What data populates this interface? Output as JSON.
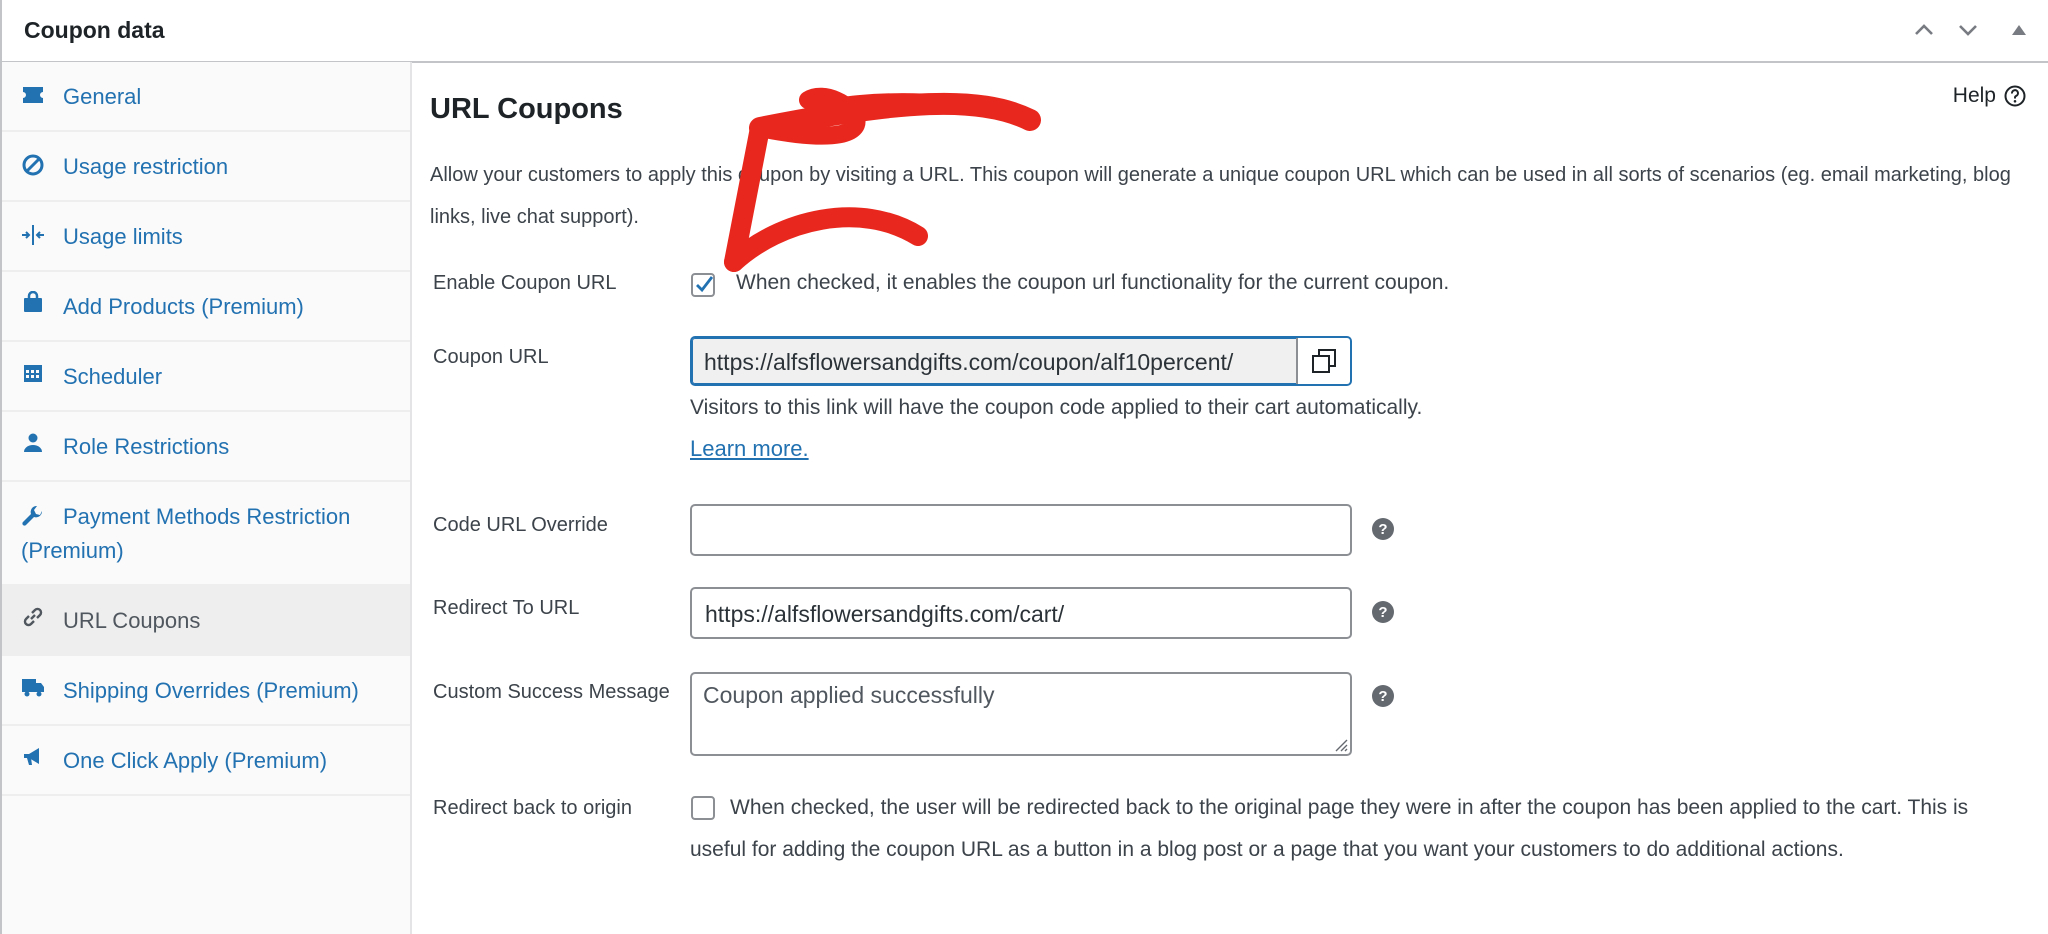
{
  "header": {
    "title": "Coupon data"
  },
  "sidebar": {
    "items": [
      {
        "label": "General",
        "icon": "ticket-icon"
      },
      {
        "label": "Usage restriction",
        "icon": "block-icon"
      },
      {
        "label": "Usage limits",
        "icon": "arrows-in-icon"
      },
      {
        "label": "Add Products (Premium)",
        "icon": "bag-icon"
      },
      {
        "label": "Scheduler",
        "icon": "calendar-icon"
      },
      {
        "label": "Role Restrictions",
        "icon": "person-icon"
      },
      {
        "label": "Payment Methods Restriction (Premium)",
        "icon": "wrench-icon"
      },
      {
        "label": "URL Coupons",
        "icon": "link-icon",
        "active": true
      },
      {
        "label": "Shipping Overrides (Premium)",
        "icon": "truck-icon"
      },
      {
        "label": "One Click Apply (Premium)",
        "icon": "megaphone-icon"
      }
    ]
  },
  "main": {
    "title": "URL Coupons",
    "help_label": "Help",
    "description": "Allow your customers to apply this coupon by visiting a URL. This coupon will generate a unique coupon URL which can be used in all sorts of scenarios (eg. email marketing, blog links, live chat support).",
    "fields": {
      "enable_coupon_url": {
        "label": "Enable Coupon URL",
        "checked": true,
        "text": "When checked, it enables the coupon url functionality for the current coupon."
      },
      "coupon_url": {
        "label": "Coupon URL",
        "value": "https://alfsflowersandgifts.com/coupon/alf10percent/",
        "help": "Visitors to this link will have the coupon code applied to their cart automatically.",
        "link": "Learn more."
      },
      "code_url_override": {
        "label": "Code URL Override",
        "value": ""
      },
      "redirect_to_url": {
        "label": "Redirect To URL",
        "value": "https://alfsflowersandgifts.com/cart/"
      },
      "custom_success_message": {
        "label": "Custom Success Message",
        "value": "Coupon applied successfully"
      },
      "redirect_back_to_origin": {
        "label": "Redirect back to origin",
        "checked": false,
        "text": "When checked, the user will be redirected back to the original page they were in after the coupon has been applied to the cart. This is useful for adding the coupon URL as a button in a blog post or a page that you want your customers to do additional actions."
      }
    }
  },
  "colors": {
    "accent": "#2271b1",
    "annotation_arrow": "#e8281e"
  }
}
